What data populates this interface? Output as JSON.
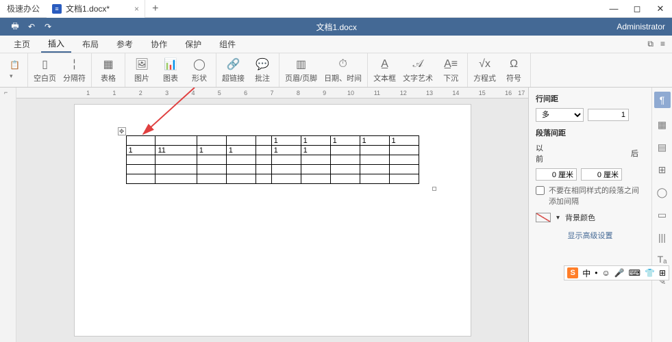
{
  "titlebar": {
    "app_name": "极速办公",
    "tab_label": "文档1.docx*",
    "new_tab": "+"
  },
  "bluebar": {
    "doc_title": "文档1.docx",
    "user": "Administrator"
  },
  "menu": {
    "items": [
      "主页",
      "插入",
      "布局",
      "参考",
      "协作",
      "保护",
      "组件"
    ],
    "active_index": 1
  },
  "ribbon": {
    "blank_page": "空白页",
    "page_break": "分隔符",
    "table": "表格",
    "picture": "图片",
    "chart": "图表",
    "shape": "形状",
    "hyperlink": "超链接",
    "comment": "批注",
    "header_footer": "页眉/页脚",
    "date_time": "日期、时间",
    "textbox": "文本框",
    "wordart": "文字艺术",
    "dropcap": "下沉",
    "equation": "方程式",
    "symbol": "符号"
  },
  "table_data": {
    "cols": 10,
    "rows": 5,
    "cells": [
      [
        "",
        "",
        "",
        "",
        "",
        "1",
        "1",
        "1",
        "1",
        "1"
      ],
      [
        "1",
        "11",
        "1",
        "1",
        "",
        "1",
        "1",
        "",
        "",
        ""
      ],
      [
        "",
        "",
        "",
        "",
        "",
        "",
        "",
        "",
        "",
        ""
      ],
      [
        "",
        "",
        "",
        "",
        "",
        "",
        "",
        "",
        "",
        ""
      ],
      [
        "",
        "",
        "",
        "",
        "",
        "",
        "",
        "",
        "",
        ""
      ]
    ]
  },
  "panel": {
    "title": "行间距",
    "spacing_mode": "多",
    "spacing_value": "1",
    "para_spacing": "段落间距",
    "before": "以前",
    "after": "后",
    "before_val": "0 厘米",
    "after_val": "0 厘米",
    "no_same_style": "不要在相同样式的段落之间添加间隔",
    "bg_color": "背景颜色",
    "advanced": "显示高级设置"
  },
  "ruler": {
    "marks": [
      "1",
      "",
      "1",
      "",
      "2",
      "",
      "3",
      "",
      "4",
      "",
      "5",
      "",
      "6",
      "",
      "7",
      "",
      "8",
      "",
      "9",
      "",
      "10",
      "",
      "11",
      "",
      "12",
      "",
      "13",
      "",
      "14",
      "",
      "15",
      "",
      "16",
      "17"
    ]
  },
  "ime": {
    "lang": "中",
    "punct": "•",
    "smile": "☺",
    "mic": "🎤",
    "kbd": "⌨",
    "shirt": "👕",
    "grid": "⊞"
  },
  "strip_icons": [
    "¶",
    "▦",
    "▤",
    "⊞",
    "◯",
    "▭",
    "|||",
    "Tₐ",
    "✎"
  ]
}
